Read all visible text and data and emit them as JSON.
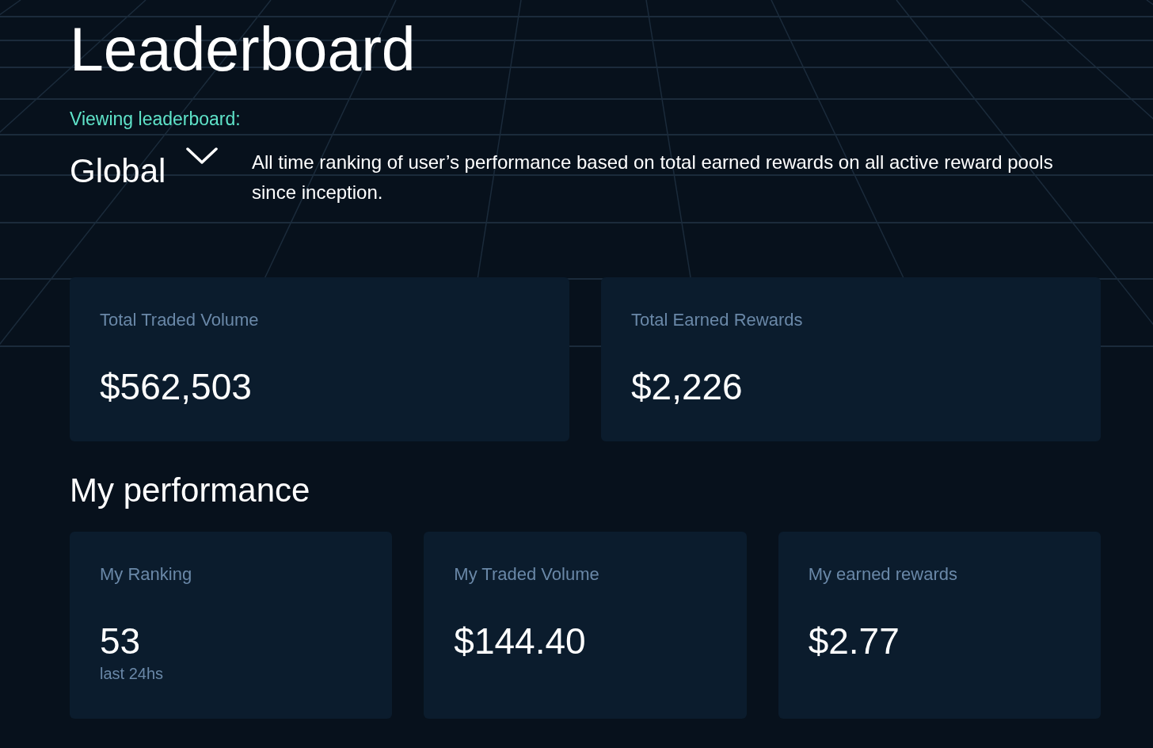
{
  "page": {
    "title": "Leaderboard"
  },
  "leaderboard_selector": {
    "label": "Viewing leaderboard:",
    "value": "Global",
    "expanded": false,
    "description": "All time ranking of user’s performance based on total earned rewards on all active reward pools since inception."
  },
  "summary_cards": [
    {
      "label": "Total Traded Volume",
      "value": "$562,503"
    },
    {
      "label": "Total Earned Rewards",
      "value": "$2,226"
    }
  ],
  "my_performance": {
    "title": "My performance",
    "cards": [
      {
        "label": "My Ranking",
        "value": "53",
        "note": "last 24hs"
      },
      {
        "label": "My Traded Volume",
        "value": "$144.40"
      },
      {
        "label": "My earned rewards",
        "value": "$2.77"
      }
    ]
  }
}
